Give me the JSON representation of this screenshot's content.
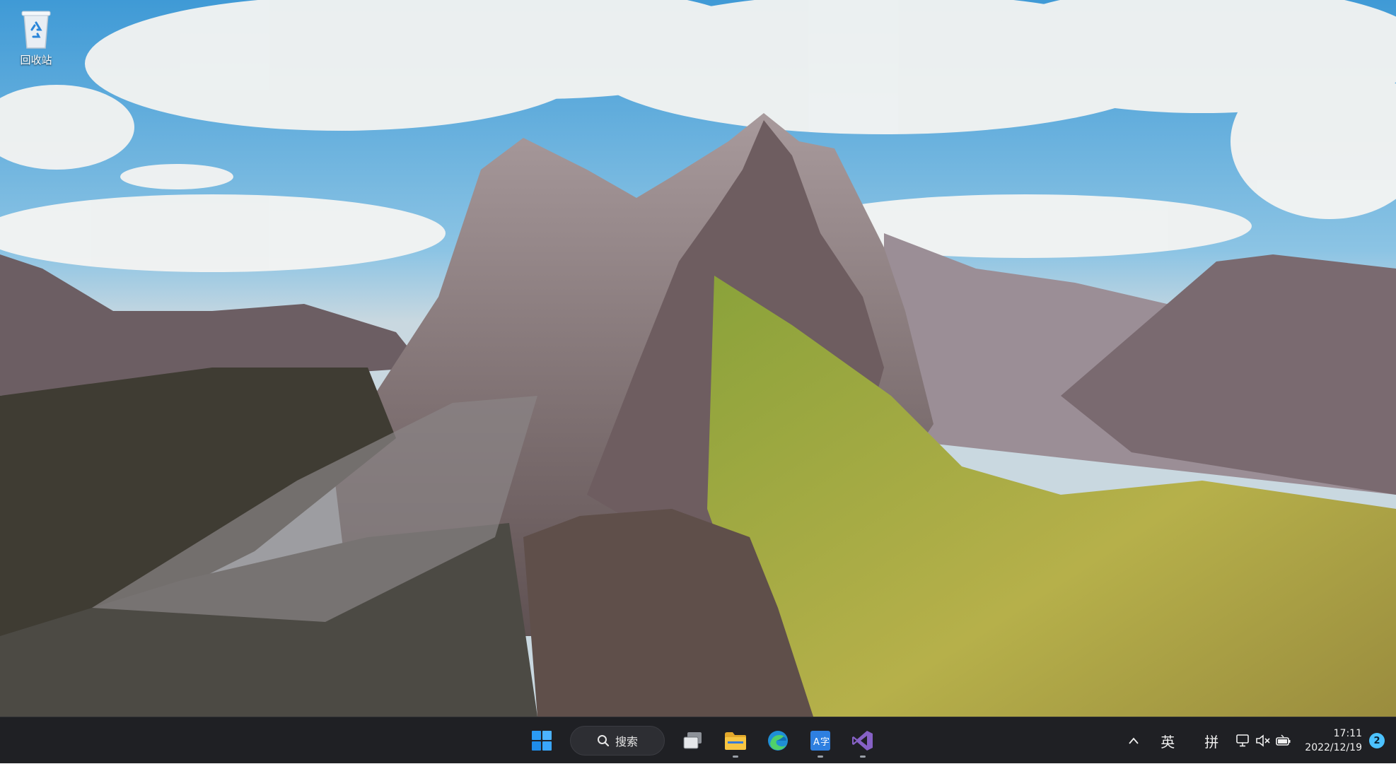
{
  "desktop": {
    "icons": [
      {
        "label": "回收站",
        "icon": "recycle-bin-icon"
      }
    ]
  },
  "taskbar": {
    "search_label": "搜索",
    "apps": [
      {
        "name": "start-icon"
      },
      {
        "name": "task-view-icon"
      },
      {
        "name": "file-explorer-icon"
      },
      {
        "name": "edge-icon"
      },
      {
        "name": "translate-app-icon"
      },
      {
        "name": "visual-studio-icon"
      }
    ],
    "tray": {
      "chevron": "^",
      "lang_en": "英",
      "ime": "拼"
    },
    "clock": {
      "time": "17:11",
      "date": "2022/12/19"
    },
    "notification_count": "2"
  },
  "colors": {
    "taskbar_bg": "#1f2024",
    "accent": "#4cc2ff",
    "start_blue": "#2b9bf4"
  }
}
